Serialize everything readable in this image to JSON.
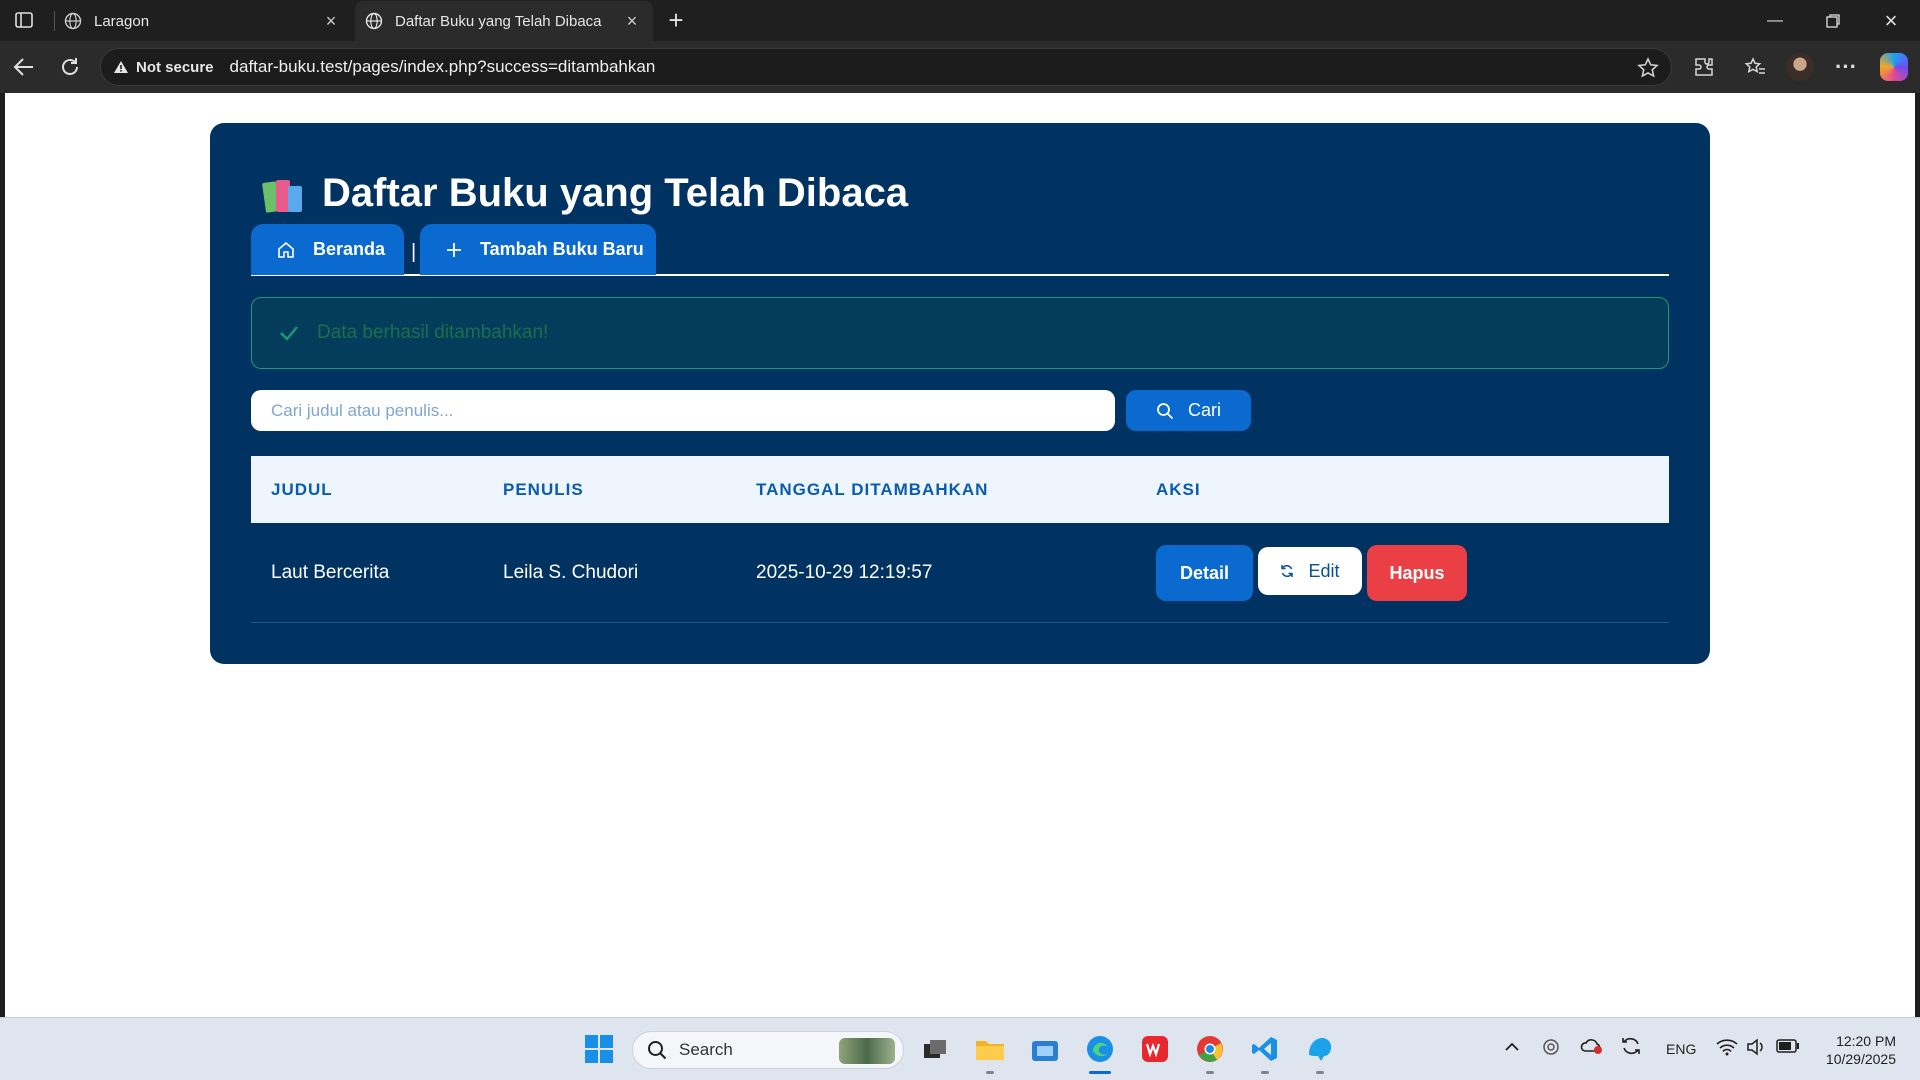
{
  "browser": {
    "tabs": [
      {
        "title": "Laragon",
        "active": false
      },
      {
        "title": "Daftar Buku yang Telah Dibaca",
        "active": true
      }
    ],
    "security_label": "Not secure",
    "url": "daftar-buku.test/pages/index.php?success=ditambahkan"
  },
  "page": {
    "title": "Daftar Buku yang Telah Dibaca",
    "nav": {
      "home_label": "Beranda",
      "separator": "|",
      "add_label": "Tambah Buku Baru"
    },
    "alert": {
      "message": "Data berhasil ditambahkan!"
    },
    "search": {
      "placeholder": "Cari judul atau penulis...",
      "button_label": "Cari"
    },
    "table": {
      "headers": [
        "JUDUL",
        "PENULIS",
        "TANGGAL DITAMBAHKAN",
        "AKSI"
      ],
      "rows": [
        {
          "judul": "Laut Bercerita",
          "penulis": "Leila S. Chudori",
          "tanggal": "2025-10-29 12:19:57",
          "actions": {
            "detail": "Detail",
            "edit": "Edit",
            "hapus": "Hapus"
          }
        }
      ]
    }
  },
  "taskbar": {
    "search_label": "Search",
    "language": "ENG",
    "time": "12:20 PM",
    "date": "10/29/2025"
  },
  "colors": {
    "card_bg": "#003262",
    "primary": "#0a6ad0",
    "danger": "#ea3f44",
    "table_header_bg": "#eef5fd",
    "alert_text": "#1b6f4e"
  }
}
